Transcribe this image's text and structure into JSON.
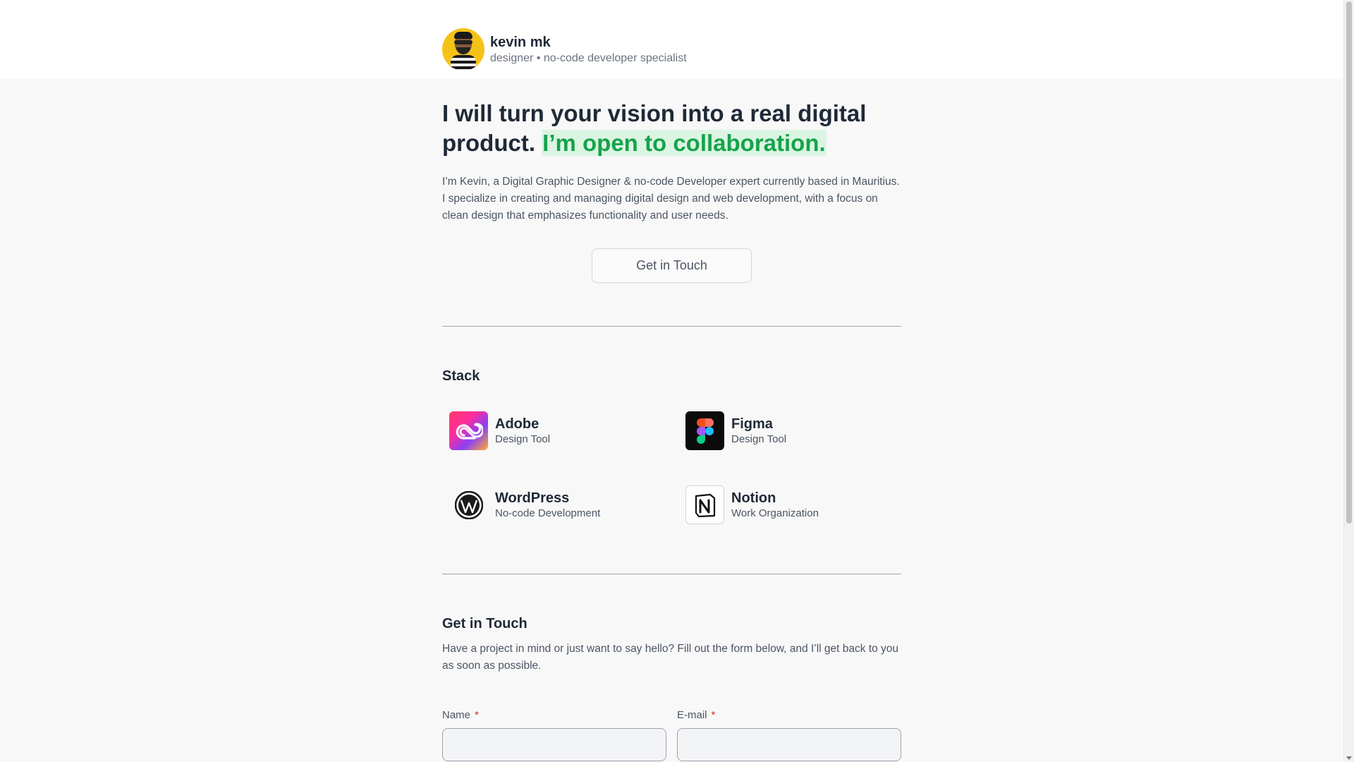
{
  "profile": {
    "name": "kevin mk",
    "role": "designer • no-code developer specialist"
  },
  "hero": {
    "headline_main": "I will turn your vision into a real digital product. ",
    "headline_highlight": "I’m open to collaboration.",
    "highlight_color": "#16a34a",
    "intro": "I’m Kevin, a Digital Graphic Designer & no-code Developer expert currently based in Mauritius. I specialize in creating and managing digital design and web development, with a focus on clean design that emphasizes functionality and user needs.",
    "cta_label": "Get in Touch"
  },
  "stack": {
    "title": "Stack",
    "items": [
      {
        "name": "Adobe",
        "desc": "Design Tool",
        "icon": "adobe-creative-cloud-icon"
      },
      {
        "name": "Figma",
        "desc": "Design Tool",
        "icon": "figma-icon"
      },
      {
        "name": "WordPress",
        "desc": "No-code Development",
        "icon": "wordpress-icon"
      },
      {
        "name": "Notion",
        "desc": "Work Organization",
        "icon": "notion-icon"
      }
    ]
  },
  "contact": {
    "title": "Get in Touch",
    "desc": "Have a project in mind or just want to say hello? Fill out the form below, and I’ll get back to you as soon as possible.",
    "name_label": "Name",
    "email_label": "E-mail",
    "required_mark": "*",
    "name_value": "",
    "email_value": ""
  }
}
